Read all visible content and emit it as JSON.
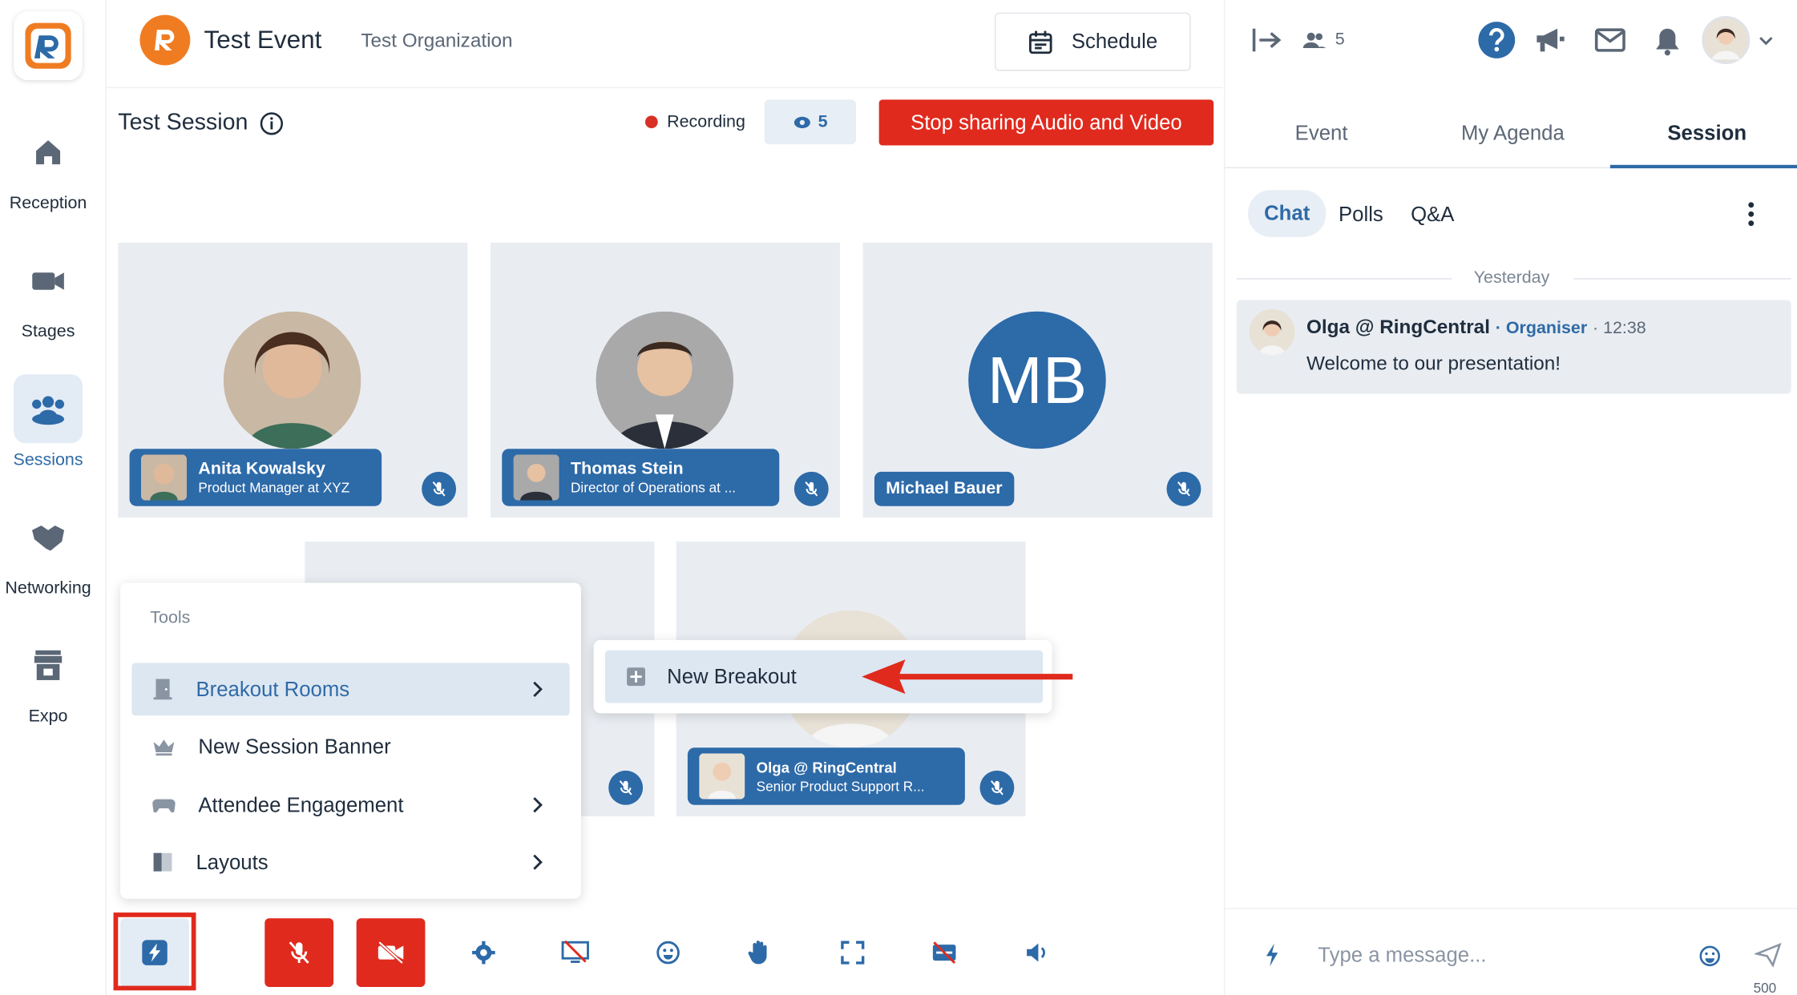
{
  "nav": {
    "items": [
      {
        "label": "Reception",
        "icon": "home-icon"
      },
      {
        "label": "Stages",
        "icon": "video-camera-icon"
      },
      {
        "label": "Sessions",
        "icon": "people-group-icon"
      },
      {
        "label": "Networking",
        "icon": "handshake-icon"
      },
      {
        "label": "Expo",
        "icon": "storefront-icon"
      }
    ],
    "active": "Sessions"
  },
  "header": {
    "event_title": "Test Event",
    "org_name": "Test Organization",
    "schedule_label": "Schedule"
  },
  "session": {
    "title": "Test Session",
    "recording_label": "Recording",
    "viewer_count": "5",
    "stop_button": "Stop sharing Audio and Video"
  },
  "participants": [
    {
      "name": "Anita Kowalsky",
      "title": "Product Manager at XYZ"
    },
    {
      "name": "Thomas Stein",
      "title": "Director of Operations at ..."
    },
    {
      "name": "Michael Bauer",
      "initials": "MB"
    },
    {
      "name": "Olga @ RingCentral",
      "title": "Senior Product Support R..."
    }
  ],
  "tools_menu": {
    "header": "Tools",
    "items": [
      {
        "label": "Breakout Rooms",
        "has_submenu": true
      },
      {
        "label": "New Session Banner",
        "has_submenu": false
      },
      {
        "label": "Attendee Engagement",
        "has_submenu": true
      },
      {
        "label": "Layouts",
        "has_submenu": true
      }
    ]
  },
  "submenu": {
    "item": "New Breakout"
  },
  "right_panel": {
    "attendee_count": "5",
    "tabs": [
      "Event",
      "My Agenda",
      "Session"
    ],
    "active_tab": "Session",
    "subtabs": [
      "Chat",
      "Polls",
      "Q&A"
    ],
    "active_subtab": "Chat",
    "day_separator": "Yesterday",
    "messages": [
      {
        "author": "Olga @ RingCentral",
        "role": "Organiser",
        "time": "12:38",
        "text": "Welcome to our presentation!"
      }
    ],
    "composer_placeholder": "Type a message...",
    "char_limit": "500"
  },
  "colors": {
    "accent": "#2d6aa8",
    "danger": "#e02a1d",
    "tile_bg": "#e9edf2",
    "brand_orange": "#f07c22"
  }
}
